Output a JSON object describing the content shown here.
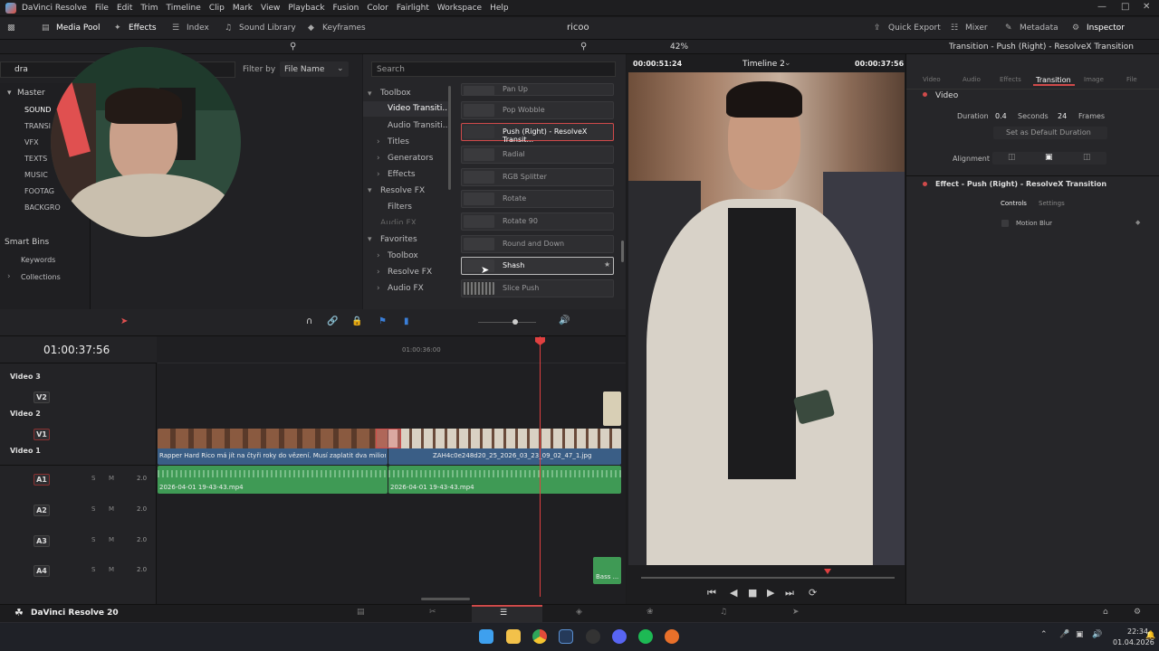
{
  "app": {
    "name": "DaVinci Resolve",
    "version_label": "DaVinci Resolve 20",
    "project": "ricoo"
  },
  "menu": [
    "File",
    "Edit",
    "Trim",
    "Timeline",
    "Clip",
    "Mark",
    "View",
    "Playback",
    "Fusion",
    "Color",
    "Fairlight",
    "Workspace",
    "Help"
  ],
  "toolbar": {
    "media_pool": "Media Pool",
    "effects": "Effects",
    "index": "Index",
    "sound_library": "Sound Library",
    "keyframes": "Keyframes",
    "quick_export": "Quick Export",
    "mixer": "Mixer",
    "metadata": "Metadata",
    "inspector": "Inspector"
  },
  "media": {
    "search_value": "dra",
    "filter_label": "Filter by",
    "filter_value": "File Name",
    "bins_master": "Master",
    "bins": [
      "SOUND",
      "TRANSI",
      "VFX",
      "TEXTS",
      "MUSIC",
      "FOOTAG",
      "BACKGRO"
    ],
    "smart_bins": "Smart Bins",
    "keywords": "Keywords",
    "collections": "Collections"
  },
  "effects": {
    "search_placeholder": "Search",
    "tree": {
      "toolbox": "Toolbox",
      "video_transitions": "Video Transiti...",
      "audio_transitions": "Audio Transiti...",
      "titles": "Titles",
      "generators": "Generators",
      "effects": "Effects",
      "resolve_fx": "Resolve FX",
      "filters": "Filters",
      "audio_fx": "Audio FX",
      "favorites": "Favorites",
      "fav_toolbox": "Toolbox",
      "fav_resolve_fx": "Resolve FX",
      "fav_audio_fx": "Audio FX"
    },
    "items": [
      "Pan Up",
      "Pop Wobble",
      "Push (Right) - ResolveX Transit...",
      "Radial",
      "RGB Splitter",
      "Rotate",
      "Rotate 90",
      "Round and Down",
      "Shash",
      "Slice Push"
    ]
  },
  "viewer": {
    "zoom": "42%",
    "timecode_left": "00:00:51:24",
    "timeline_name": "Timeline 2",
    "timecode_right": "00:00:37:56"
  },
  "inspector": {
    "title": "Transition - Push (Right) - ResolveX Transition",
    "tabs": [
      "Video",
      "Audio",
      "Effects",
      "Transition",
      "Image",
      "File"
    ],
    "section_video": "Video",
    "duration_label": "Duration",
    "duration_value": "0.4",
    "seconds_label": "Seconds",
    "frames_value": "24",
    "frames_label": "Frames",
    "default_duration": "Set as Default Duration",
    "alignment_label": "Alignment",
    "effect_title": "Effect - Push (Right) - ResolveX Transition",
    "subtabs": [
      "Controls",
      "Settings"
    ],
    "motion_blur": "Motion Blur"
  },
  "timeline": {
    "timecode": "01:00:37:56",
    "ruler_mark": "01:00:36:00",
    "tracks": {
      "video3": "Video 3",
      "v2": "V2",
      "video2": "Video 2",
      "v1": "V1",
      "video1": "Video 1",
      "a1": "A1",
      "a2": "A2",
      "a3": "A3",
      "a4": "A4",
      "s": "S",
      "m": "M",
      "level": "2.0"
    },
    "clips": {
      "v1_clip1": "Rapper Hard Rico má jít na čtyři roky do vězení. Musí zaplatit dva milion...",
      "v1_clip2": "ZAH4c0e248d20_25_2026_03_23_09_02_47_1.jpg",
      "a1_clip1": "2026-04-01 19-43-43.mp4",
      "a1_clip2": "2026-04-01 19-43-43.mp4",
      "a4_clip": "Bass ..."
    }
  },
  "taskbar": {
    "time": "22:34",
    "date": "01.04.2026"
  },
  "colors": {
    "accent_red": "#d04a4a",
    "audio_clip": "#3f9a55",
    "video_clip": "#3a5e86"
  }
}
